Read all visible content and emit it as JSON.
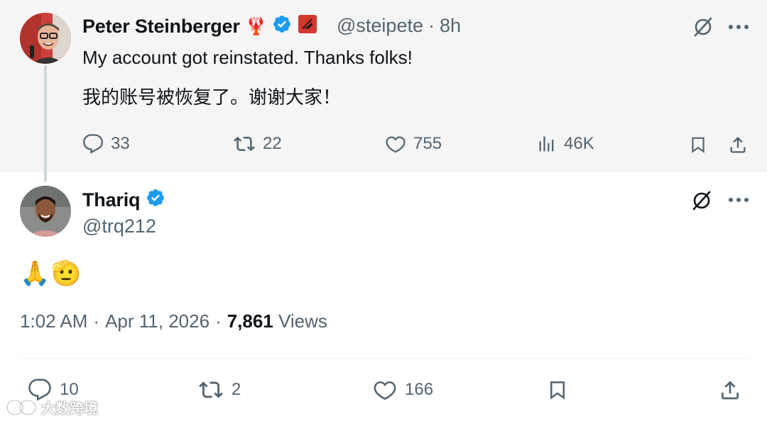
{
  "parent_tweet": {
    "author_name": "Peter Steinberger",
    "name_emoji": "🦞",
    "handle": "@steipete",
    "separator": "·",
    "time": "8h",
    "text_en": "My account got reinstated. Thanks folks!",
    "text_zh": "我的账号被恢复了。谢谢大家！",
    "replies": "33",
    "reposts": "22",
    "likes": "755",
    "views": "46K"
  },
  "reply_tweet": {
    "author_name": "Thariq",
    "handle": "@trq212",
    "text": "🙏🫡",
    "time": "1:02 AM",
    "sep1": "·",
    "date": "Apr 11, 2026",
    "sep2": "·",
    "views_count": "7,861",
    "views_label": "Views",
    "replies": "10",
    "reposts": "2",
    "likes": "166"
  },
  "watermark": {
    "text": "大数跨境"
  },
  "colors": {
    "verified": "#1d9bf0",
    "secondary_text": "#536471",
    "parent_bg": "#f5f5f5"
  },
  "icons": [
    "grok-icon",
    "more-icon",
    "reply-icon",
    "repost-icon",
    "like-icon",
    "views-icon",
    "bookmark-icon",
    "share-icon",
    "verified-badge-icon",
    "affiliate-badge-icon"
  ]
}
